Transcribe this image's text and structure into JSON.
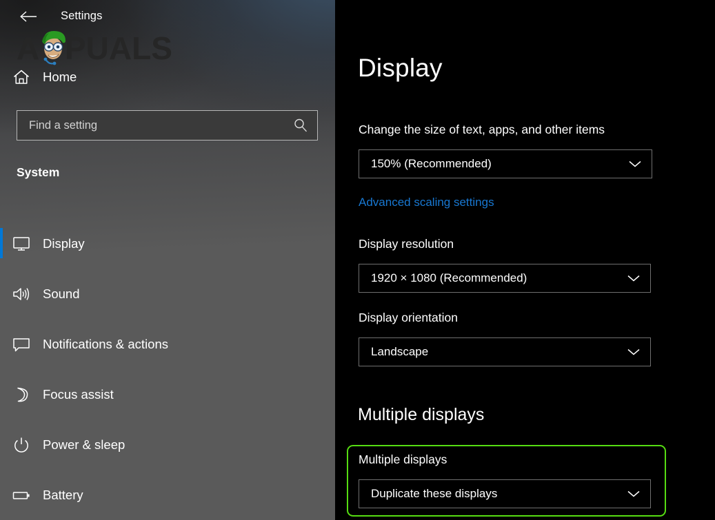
{
  "window": {
    "title": "Settings",
    "back_icon": "back-arrow-icon"
  },
  "watermark": {
    "text": "APPUALS"
  },
  "sidebar": {
    "home": {
      "label": "Home",
      "icon": "home-icon"
    },
    "search": {
      "placeholder": "Find a setting",
      "value": "",
      "icon": "search-icon"
    },
    "section_header": "System",
    "accent_color": "#0078d7",
    "items": [
      {
        "label": "Display",
        "icon": "monitor-icon",
        "selected": true
      },
      {
        "label": "Sound",
        "icon": "speaker-icon",
        "selected": false
      },
      {
        "label": "Notifications & actions",
        "icon": "notification-icon",
        "selected": false
      },
      {
        "label": "Focus assist",
        "icon": "moon-icon",
        "selected": false
      },
      {
        "label": "Power & sleep",
        "icon": "power-icon",
        "selected": false
      },
      {
        "label": "Battery",
        "icon": "battery-icon",
        "selected": false
      }
    ]
  },
  "main": {
    "page_title": "Display",
    "scale": {
      "label": "Change the size of text, apps, and other items",
      "value": "150% (Recommended)"
    },
    "advanced_link": "Advanced scaling settings",
    "resolution": {
      "label": "Display resolution",
      "value": "1920 × 1080 (Recommended)"
    },
    "orientation": {
      "label": "Display orientation",
      "value": "Landscape"
    },
    "multiple_displays": {
      "heading": "Multiple displays",
      "sub_label": "Multiple displays",
      "value": "Duplicate these displays",
      "highlight_color": "#56dd12"
    },
    "link_color": "#1878d2"
  }
}
